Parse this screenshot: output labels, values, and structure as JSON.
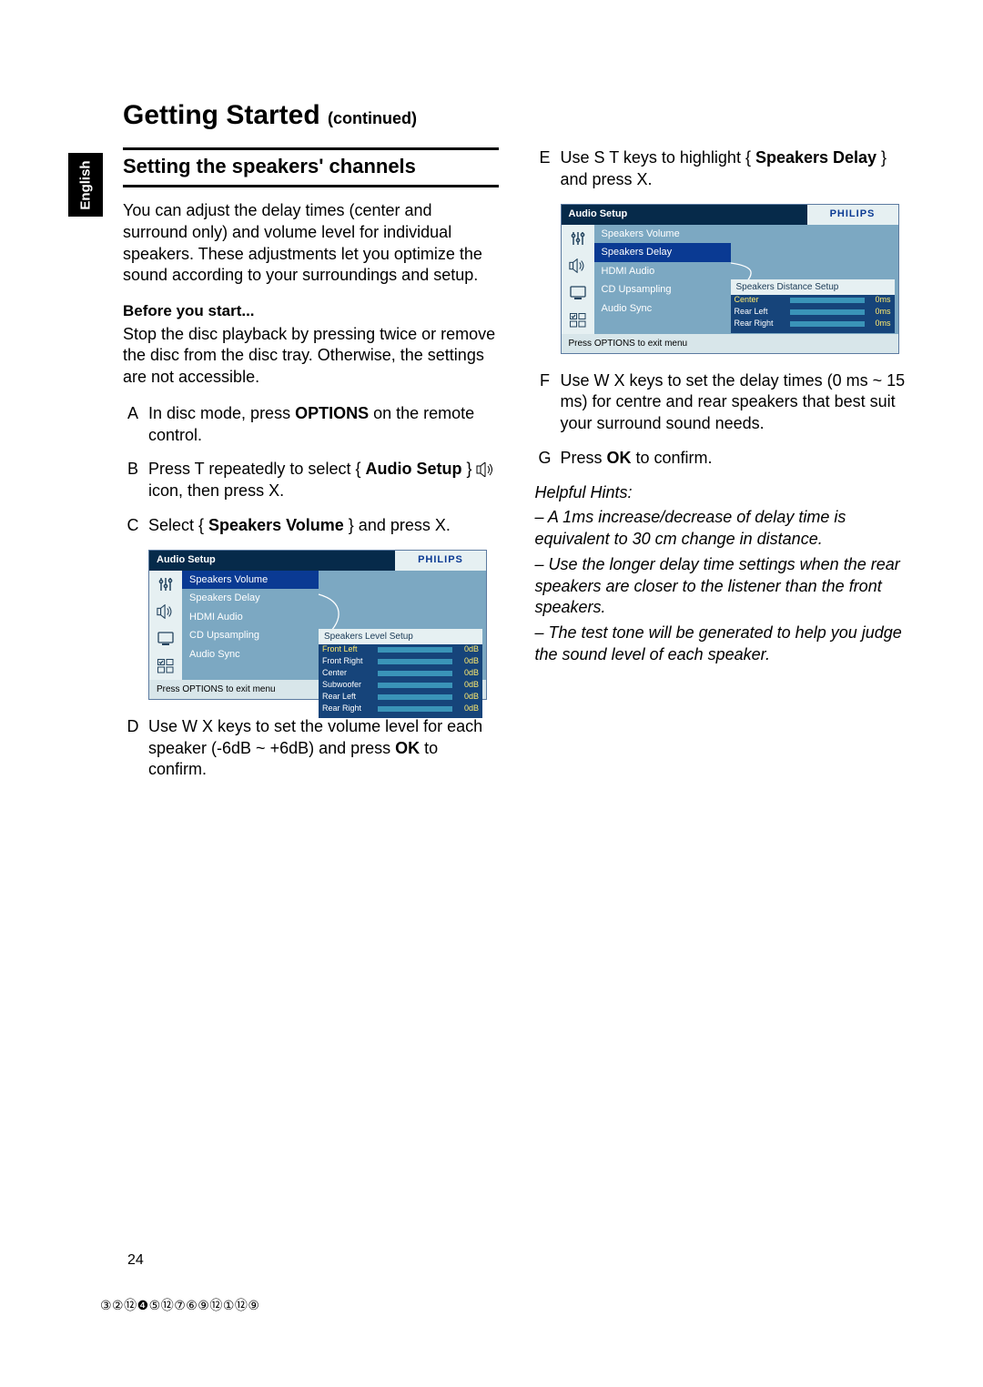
{
  "language_tab": "English",
  "page_title": {
    "main": "Getting Started",
    "suffix": "(continued)"
  },
  "section_heading": "Setting the speakers' channels",
  "intro_paragraph": "You can adjust the delay times (center and surround only) and volume level for individual speakers. These adjustments let you optimize the sound according to your surroundings and setup.",
  "before_you_start_label": "Before you start...",
  "before_you_start_body": "Stop the disc playback by pressing twice or remove the disc from the disc tray. Otherwise, the settings are not accessible.",
  "steps": {
    "A": {
      "pre": "In disc mode, press ",
      "bold": "OPTIONS",
      "post": " on the remote control."
    },
    "B": {
      "pre": "Press T repeatedly to select { ",
      "bold": "Audio Setup",
      "post": " } ",
      "icon_name": "speaker-icon",
      "post2": " icon, then press X."
    },
    "C": {
      "pre": "Select { ",
      "bold": "Speakers Volume",
      "post": " } and press X."
    },
    "D": {
      "pre": "Use W X keys to set the volume level for each speaker (-6dB ~ +6dB) and press ",
      "bold": "OK",
      "post": " to conﬁrm."
    },
    "E": {
      "pre": "Use S T keys to highlight { ",
      "bold": "Speakers Delay",
      "post": " } and press X."
    },
    "F": "Use W X keys to set the delay times (0 ms ~ 15 ms) for centre and rear speakers that best suit your surround sound needs.",
    "G": {
      "pre": "Press ",
      "bold": "OK",
      "post": " to conﬁrm."
    }
  },
  "ui_panel": {
    "title": "Audio Setup",
    "brand": "PHILIPS",
    "menu_items": [
      "Speakers Volume",
      "Speakers Delay",
      "HDMI Audio",
      "CD Upsampling",
      "Audio Sync"
    ],
    "footer": "Press OPTIONS to exit menu",
    "panel1": {
      "selected_index": 0,
      "sub_title": "Speakers Level Setup",
      "rows": [
        {
          "label": "Front Left",
          "value": "0dB",
          "highlight": true
        },
        {
          "label": "Front Right",
          "value": "0dB"
        },
        {
          "label": "Center",
          "value": "0dB"
        },
        {
          "label": "Subwoofer",
          "value": "0dB"
        },
        {
          "label": "Rear Left",
          "value": "0dB"
        },
        {
          "label": "Rear Right",
          "value": "0dB"
        }
      ]
    },
    "panel2": {
      "selected_index": 1,
      "sub_title": "Speakers Distance Setup",
      "rows": [
        {
          "label": "Center",
          "value": "0ms",
          "highlight": true
        },
        {
          "label": "Rear Left",
          "value": "0ms"
        },
        {
          "label": "Rear Right",
          "value": "0ms"
        }
      ]
    }
  },
  "hints_label": "Helpful Hints:",
  "hints": [
    "– A 1ms increase/decrease of delay time is equivalent to 30 cm change in distance.",
    "– Use the longer delay time settings when the rear speakers are closer to the listener than the front speakers.",
    "– The test tone will be generated to help you judge the sound level of each speaker."
  ],
  "page_number": "24",
  "footer_code": "③②⑫❹⑤⑫⑦⑥⑨⑫①⑫⑨"
}
